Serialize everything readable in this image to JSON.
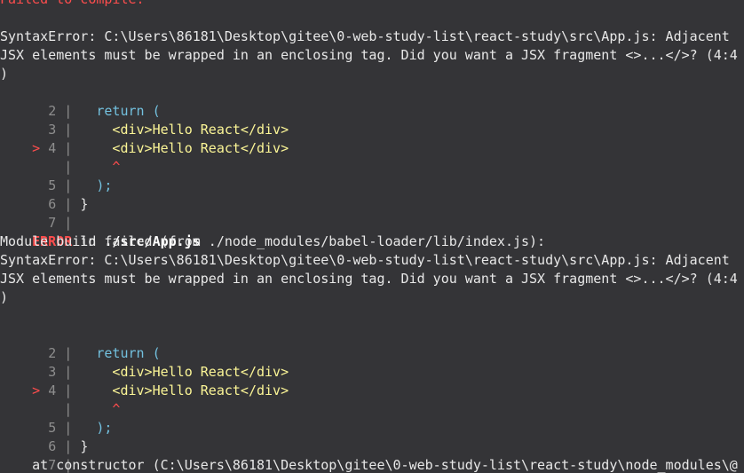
{
  "header": {
    "failed_text": "Failed to compile."
  },
  "first_error": {
    "message_line1": "SyntaxError: C:\\Users\\86181\\Desktop\\gitee\\0-web-study-list\\react-study\\src\\App.js: Adjacent",
    "message_line2": "JSX elements must be wrapped in an enclosing tag. Did you want a JSX fragment <>...</>? (4:4",
    "message_line3": ")"
  },
  "code_frame": {
    "rows": [
      {
        "marker": " ",
        "num": "2",
        "code": "  return ("
      },
      {
        "marker": " ",
        "num": "3",
        "code": "    <div>Hello React</div>"
      },
      {
        "marker": ">",
        "num": "4",
        "code": "    <div>Hello React</div>"
      },
      {
        "marker": " ",
        "num": " ",
        "code": "    ^"
      },
      {
        "marker": " ",
        "num": "5",
        "code": "  );"
      },
      {
        "marker": " ",
        "num": "6",
        "code": "}"
      },
      {
        "marker": " ",
        "num": "7",
        "code": ""
      }
    ]
  },
  "second_error": {
    "label": "ERROR",
    "in_word": " in ",
    "file": "./src/App.js",
    "module_build": "Module build failed (from ./node_modules/babel-loader/lib/index.js):",
    "message_line1": "SyntaxError: C:\\Users\\86181\\Desktop\\gitee\\0-web-study-list\\react-study\\src\\App.js: Adjacent",
    "message_line2": "JSX elements must be wrapped in an enclosing tag. Did you want a JSX fragment <>...</>? (4:4",
    "message_line3": ")"
  },
  "stack": {
    "line": "    at constructor (C:\\Users\\86181\\Desktop\\gitee\\0-web-study-list\\react-study\\node_modules\\@"
  }
}
